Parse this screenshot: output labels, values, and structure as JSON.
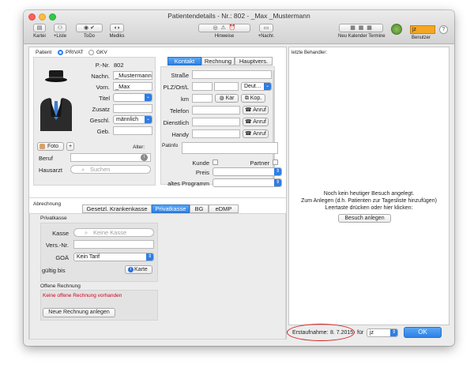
{
  "window": {
    "title": "Patientendetails - Nr.: 802 - _Max _Mustermann"
  },
  "toolbar": {
    "kartei": "Kartei",
    "liste": "+Liste",
    "todo": "ToDo",
    "mediks": "Mediks",
    "hinweise": "Hinweise",
    "nachr": "+Nachr.",
    "neu": "Neu",
    "kalender": "Kalender",
    "termine": "Termine",
    "user_field": "jz",
    "benutzer": "Benutzer",
    "help": "?"
  },
  "patient": {
    "label": "Patient",
    "privat": "PRIVAT",
    "gkv": "GKV",
    "nr_label": "P.-Nr.",
    "nr": "802",
    "nachname_label": "Nachn.",
    "nachname": "_Mustermann",
    "vorname_label": "Vorn.",
    "vorname": "_Max",
    "titel_label": "Titel",
    "zusatz_label": "Zusatz",
    "geschl_label": "Geschl.",
    "geschl": "männlich",
    "geb_label": "Geb.",
    "alter_label": "Alter:",
    "foto_label": "Foto",
    "plus": "+",
    "beruf_label": "Beruf",
    "hausarzt_label": "Hausarzt",
    "suchen_placeholder": "Suchen"
  },
  "contact_tabs": [
    "Kontakt",
    "Rechnung",
    "Hauptvers."
  ],
  "kontakt": {
    "strasse": "Straße",
    "plz": "PLZ/Ort/L",
    "land": "Deut…",
    "km": "km",
    "karte_btn": "Kar",
    "kop_btn": "Kop.",
    "telefon": "Telefon",
    "dienstlich": "Dienstlich",
    "handy": "Handy",
    "anruf": "Anruf",
    "patinfo": "Patinfo",
    "kunde": "Kunde",
    "partner": "Partner",
    "preis": "Preis",
    "altes_programm": "altes Programm"
  },
  "right": {
    "letzte": "letzte Behandler:",
    "msg1": "Noch kein heutiger Besuch angelegt.",
    "msg2": "Zum Anlegen (d.h. Patienten zur Tagesliste hinzufügen)",
    "msg3": "Leertaste drücken oder hier klicken:",
    "besuch_btn": "Besuch anlegen"
  },
  "abrechnung": {
    "label": "Abrechnung",
    "tabs": [
      "Gesetzl. Krankenkasse",
      "Privatkasse",
      "BG",
      "eDMP"
    ],
    "privatkasse_head": "Privatkasse",
    "kasse_label": "Kasse",
    "kasse_placeholder": "Keine Kasse",
    "versnr_label": "Vers.-Nr.",
    "goa_label": "GOÄ",
    "goa_value": "Kein Tarif",
    "gueltig_label": "gültig bis",
    "karte_btn": "Karte",
    "offene_head": "Offene Rechnung",
    "offene_msg": "Keine offene Rechnung vorhanden",
    "neue_btn": "Neue Rechnung anlegen"
  },
  "footer": {
    "erst_label": "Erstaufnahme:",
    "erst_date": "8. 7.2015",
    "fuer": "für",
    "fuer_value": "jz",
    "ok": "OK"
  },
  "colors": {
    "accent": "#2c80e6",
    "error": "#d0021b",
    "highlight": "#d21e1e",
    "user_field": "#f5a623"
  }
}
